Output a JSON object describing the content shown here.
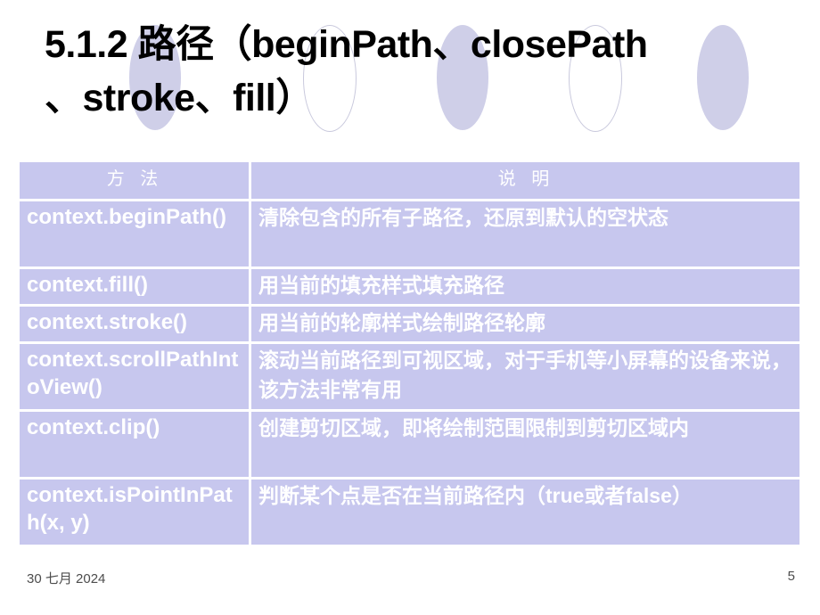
{
  "slide": {
    "title_line1": "5.1.2  路径（beginPath、closePath",
    "title_line2": "、stroke、fill）",
    "background_color": "#ffffff",
    "accent_color": "#c7c7ee",
    "decoration_fill_color": "#cfcfe8",
    "decoration_outline_color": "#c9c9dd"
  },
  "table": {
    "headers": {
      "method": "方 法",
      "description": "说 明"
    },
    "rows": [
      {
        "method": "context.beginPath()",
        "description": "清除包含的所有子路径，还原到默认的空状态"
      },
      {
        "method": "context.fill()",
        "description": "用当前的填充样式填充路径"
      },
      {
        "method": "context.stroke()",
        "description": "用当前的轮廓样式绘制路径轮廓"
      },
      {
        "method": "context.scrollPathIntoView()",
        "description": "滚动当前路径到可视区域，对于手机等小屏幕的设备来说，该方法非常有用"
      },
      {
        "method": "context.clip()",
        "description": "创建剪切区域，即将绘制范围限制到剪切区域内"
      },
      {
        "method": "context.isPointInPath(x, y)",
        "description": "判断某个点是否在当前路径内（true或者false）"
      }
    ]
  },
  "footer": {
    "date": "30 七月 2024",
    "page_number": "5"
  }
}
